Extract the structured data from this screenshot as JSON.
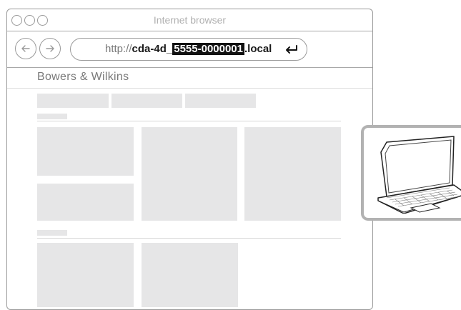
{
  "window": {
    "title": "Internet browser"
  },
  "address_bar": {
    "scheme": "http://",
    "host_prefix": "cda-4d_",
    "serial": "5555-0000001",
    "suffix": ".local"
  },
  "website": {
    "brand": "Bowers & Wilkins"
  },
  "icons": {
    "back": "back-arrow-icon",
    "forward": "forward-arrow-icon",
    "enter": "enter-return-icon",
    "device": "laptop-icon"
  },
  "colors": {
    "placeholder_block": "#e6e6e7",
    "highlight_bg": "#111111",
    "highlight_fg": "#ffffff",
    "device_frame": "#b2b2b2"
  }
}
